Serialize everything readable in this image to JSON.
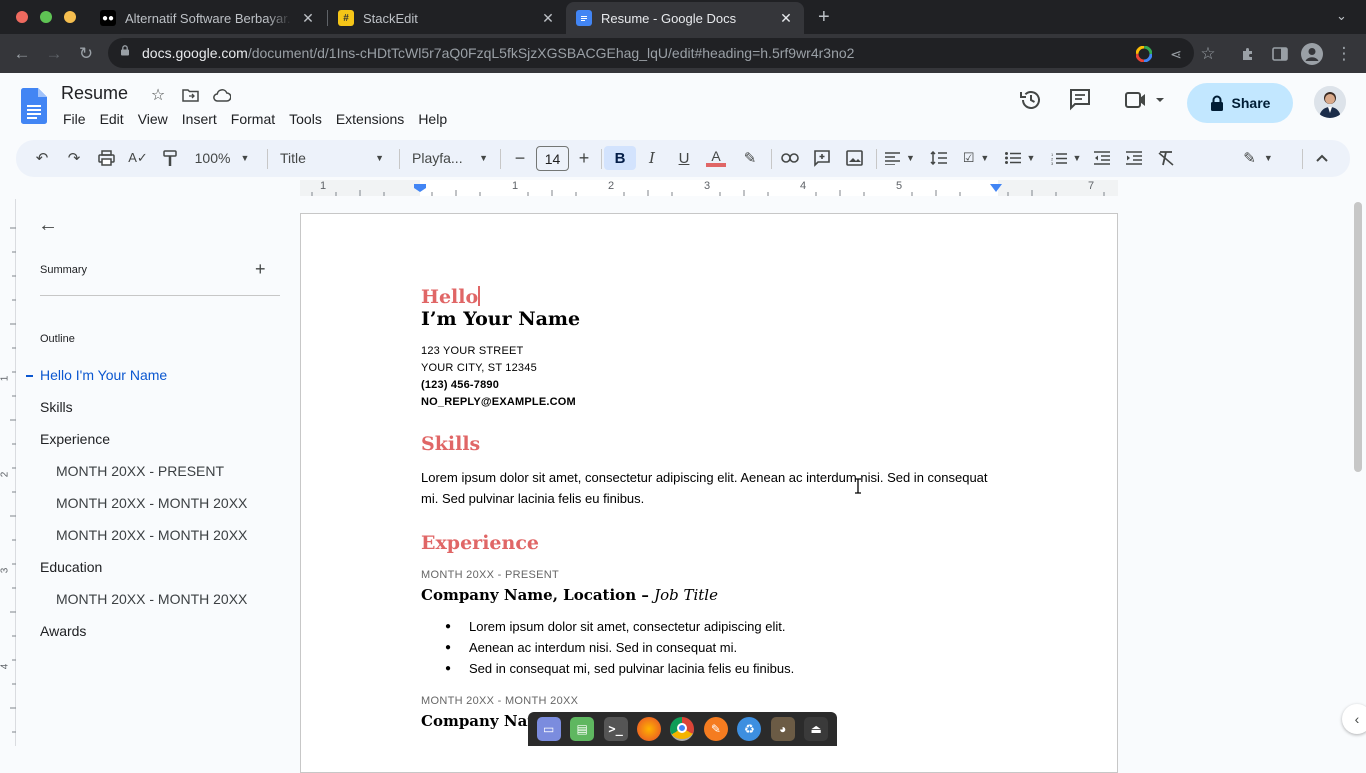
{
  "browser": {
    "tabs": [
      {
        "title": "Alternatif Software Berbayar. A",
        "active": false
      },
      {
        "title": "StackEdit",
        "active": false
      },
      {
        "title": "Resume - Google Docs",
        "active": true
      }
    ],
    "new_tab_label": "+",
    "url_host": "docs.google.com",
    "url_path": "/document/d/1Ins-cHDtTcWl5r7aQ0FzqL5fkSjzXGSBACGEhag_lqU/edit#heading=h.5rf9wr4r3no2"
  },
  "docs": {
    "doc_title": "Resume",
    "menu": [
      "File",
      "Edit",
      "View",
      "Insert",
      "Format",
      "Tools",
      "Extensions",
      "Help"
    ],
    "share_label": "Share",
    "toolbar": {
      "zoom": "100%",
      "style": "Title",
      "font": "Playfa...",
      "font_size": "14"
    },
    "ruler_numbers": [
      "1",
      "1",
      "2",
      "3",
      "4",
      "5",
      "6",
      "7"
    ],
    "vruler_numbers": [
      "1",
      "2",
      "3",
      "4"
    ]
  },
  "sidebar": {
    "summary_label": "Summary",
    "outline_label": "Outline",
    "items": [
      {
        "label": "Hello I'm Your Name",
        "level": 1,
        "active": true
      },
      {
        "label": "Skills",
        "level": 1,
        "active": false
      },
      {
        "label": "Experience",
        "level": 1,
        "active": false
      },
      {
        "label": "MONTH 20XX - PRESENT",
        "level": 3,
        "active": false
      },
      {
        "label": "MONTH 20XX - MONTH 20XX",
        "level": 3,
        "active": false
      },
      {
        "label": "MONTH 20XX - MONTH 20XX",
        "level": 3,
        "active": false
      },
      {
        "label": "Education",
        "level": 1,
        "active": false
      },
      {
        "label": "MONTH 20XX - MONTH 20XX",
        "level": 3,
        "active": false
      },
      {
        "label": "Awards",
        "level": 1,
        "active": false
      }
    ]
  },
  "document": {
    "hello": "Hello",
    "name": "I’m Your Name",
    "address": [
      "123 YOUR STREET",
      "YOUR CITY, ST 12345"
    ],
    "phone": "(123) 456-7890",
    "email": "NO_REPLY@EXAMPLE.COM",
    "skills_heading": "Skills",
    "skills_text": "Lorem ipsum dolor sit amet, consectetur adipiscing elit. Aenean ac interdum nisi. Sed in consequat mi. Sed pulvinar lacinia felis eu finibus.",
    "experience_heading": "Experience",
    "job1_date": "MONTH 20XX - PRESENT",
    "job1_company": "Company Name, Location",
    "job1_sep": " – ",
    "job1_title": "Job Title",
    "job1_bullets": [
      "Lorem ipsum dolor sit amet, consectetur adipiscing elit.",
      "Aenean ac interdum nisi. Sed in consequat mi.",
      "Sed in consequat mi, sed pulvinar lacinia felis eu finibus."
    ],
    "job2_date": "MONTH 20XX - MONTH 20XX",
    "job2_company": "Company Name"
  },
  "colors": {
    "accent_heading": "#e06666",
    "share_bg": "#c2e7ff",
    "outline_active": "#0b57d0"
  }
}
